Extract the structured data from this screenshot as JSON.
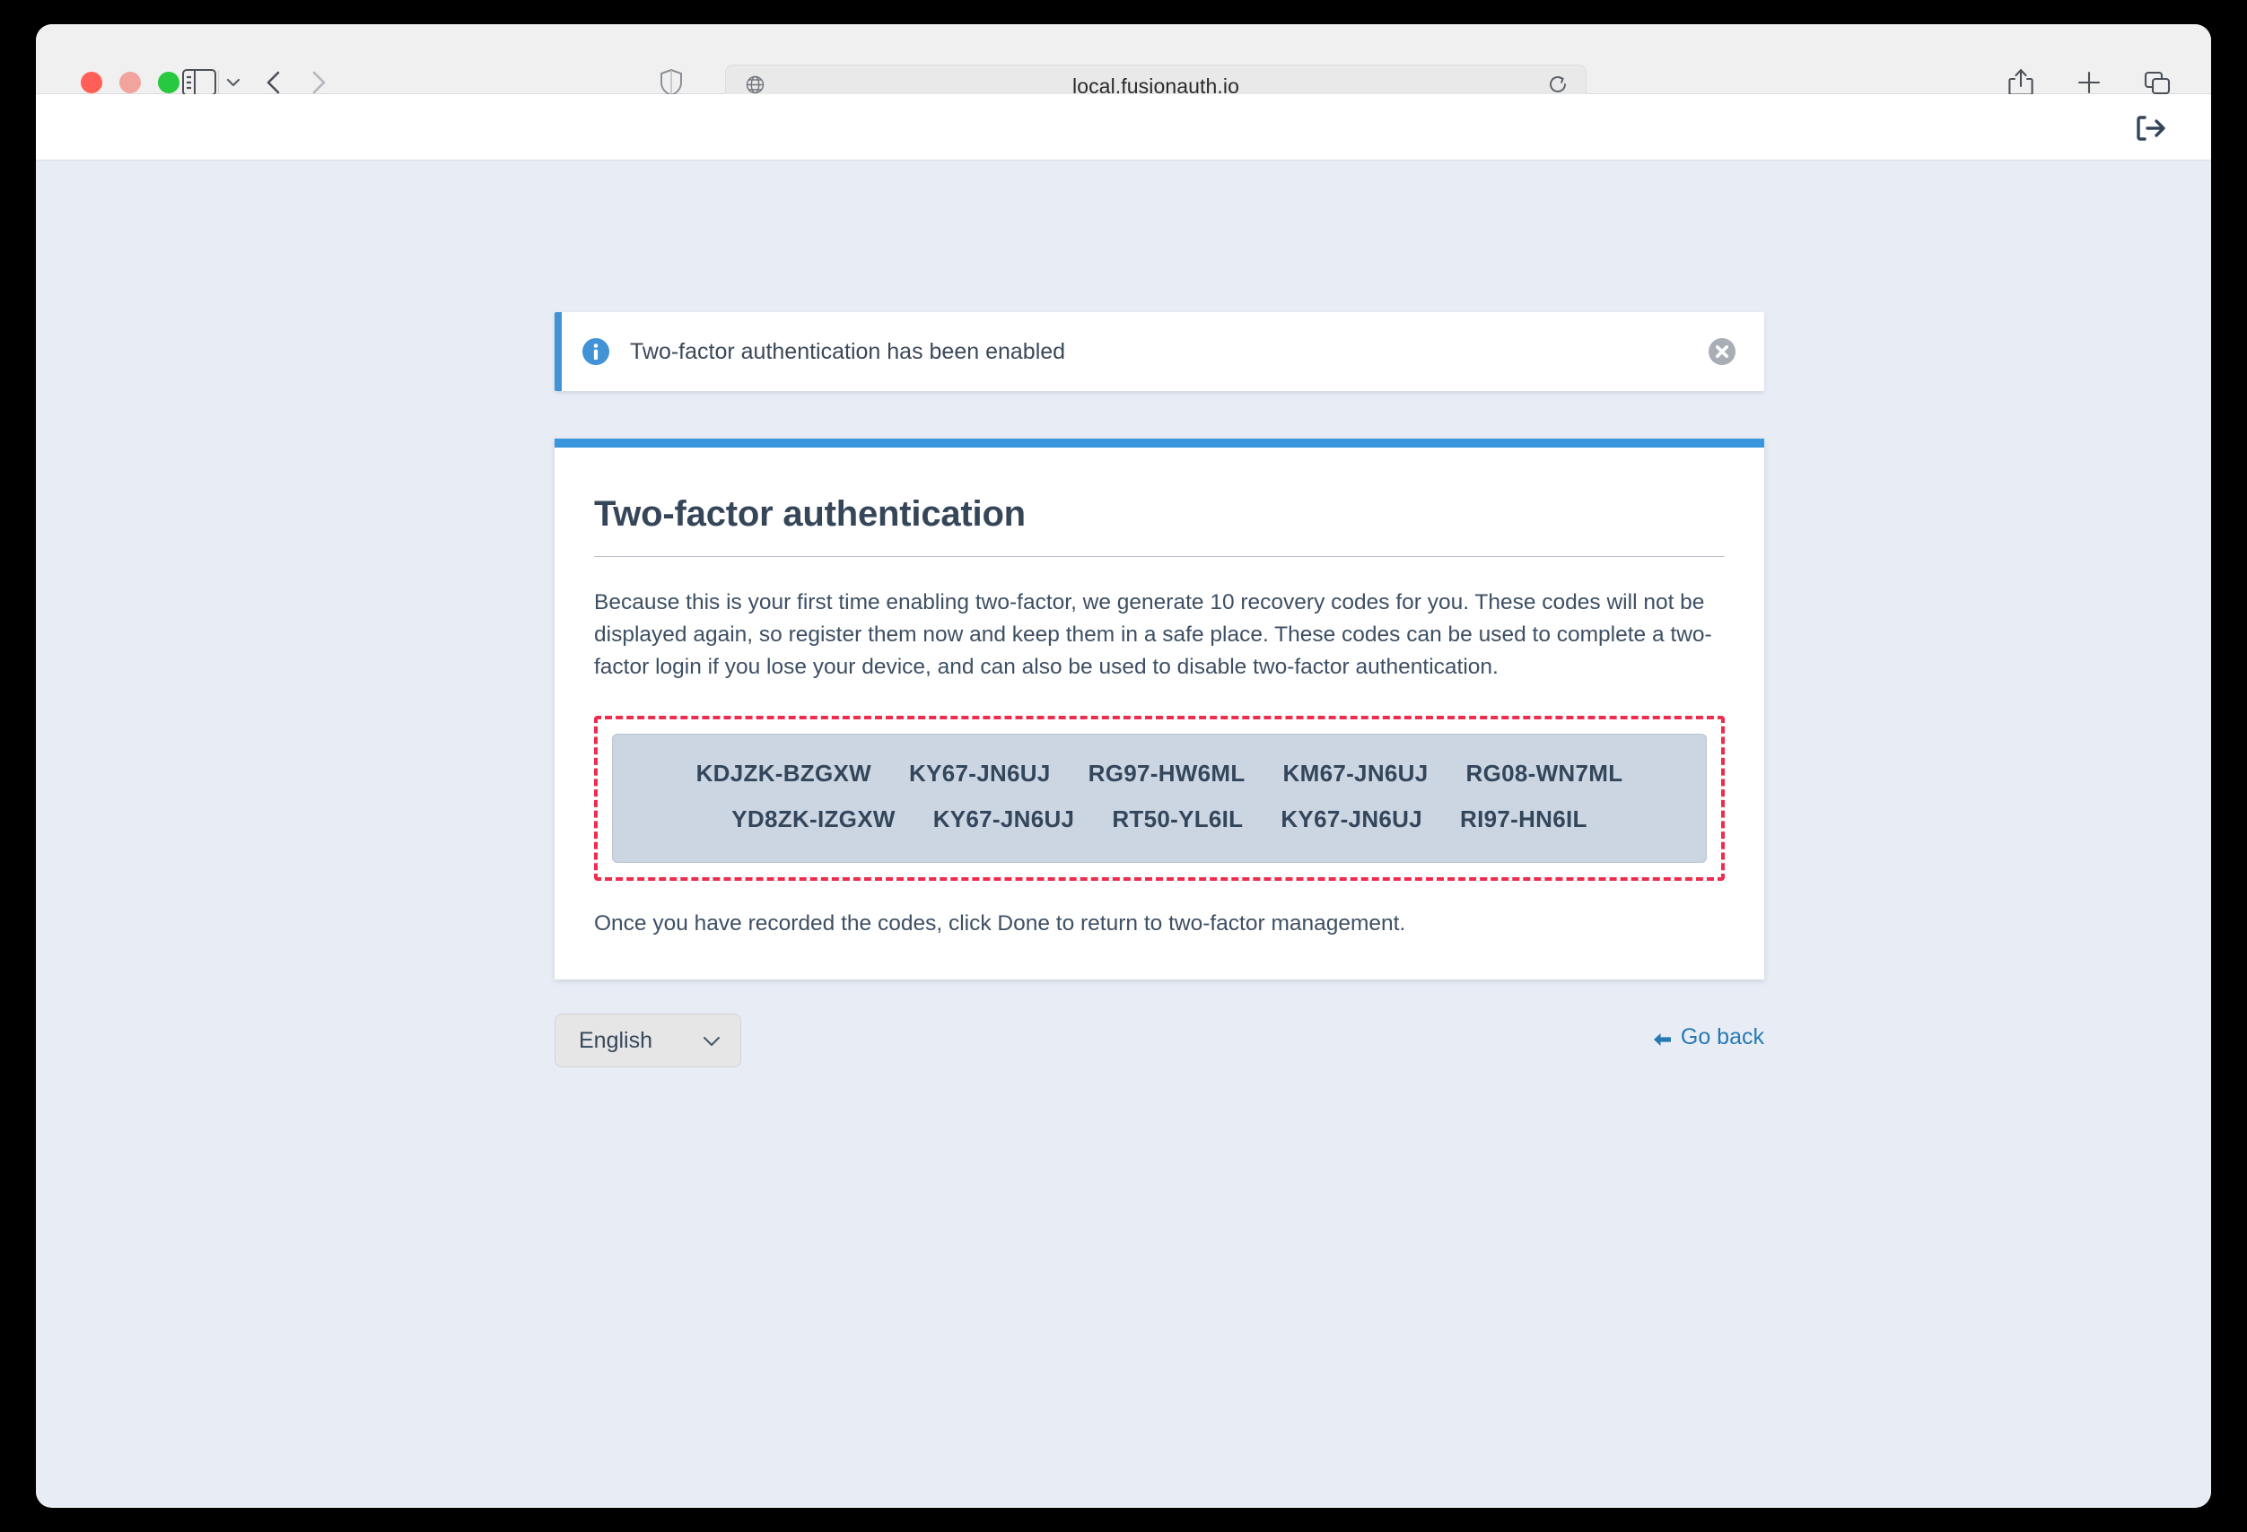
{
  "browser": {
    "url": "local.fusionauth.io",
    "traffic_lights": [
      "close",
      "minimize",
      "maximize"
    ],
    "icons": {
      "sidebar_toggle": "sidebar-toggle-icon",
      "tab_overview_chevron": "chevron-down-icon",
      "back": "chevron-left-icon",
      "forward": "chevron-right-icon",
      "shield": "shield-icon",
      "globe": "globe-icon",
      "reload": "reload-icon",
      "share": "share-icon",
      "new_tab": "plus-icon",
      "tabs": "tabs-icon"
    }
  },
  "app_header": {
    "logout_icon": "logout-icon"
  },
  "alert": {
    "icon": "info-circle-icon",
    "message": "Two-factor authentication has been enabled",
    "close_icon": "close-circle-icon",
    "accent_color": "#4193d6"
  },
  "card": {
    "accent_color": "#3b97dd",
    "title": "Two-factor authentication",
    "paragraph": "Because this is your first time enabling two-factor, we generate 10 recovery codes for you. These codes will not be displayed again, so register them now and keep them in a safe place. These codes can be used to complete a two-factor login if you lose your device, and can also be used to disable two-factor authentication.",
    "footnote": "Once you have recorded the codes, click Done to return to two-factor management.",
    "recovery_codes": {
      "highlight_color": "#ed2d4e",
      "background_color": "#ccd6e2",
      "rows": [
        [
          "KDJZK-BZGXW",
          "KY67-JN6UJ",
          "RG97-HW6ML",
          "KM67-JN6UJ",
          "RG08-WN7ML"
        ],
        [
          "YD8ZK-IZGXW",
          "KY67-JN6UJ",
          "RT50-YL6IL",
          "KY67-JN6UJ",
          "RI97-HN6IL"
        ]
      ]
    }
  },
  "footer": {
    "language": "English",
    "language_chevron_icon": "chevron-down-icon",
    "go_back_label": "Go back",
    "go_back_icon": "arrow-left-icon",
    "link_color": "#2779b4"
  }
}
